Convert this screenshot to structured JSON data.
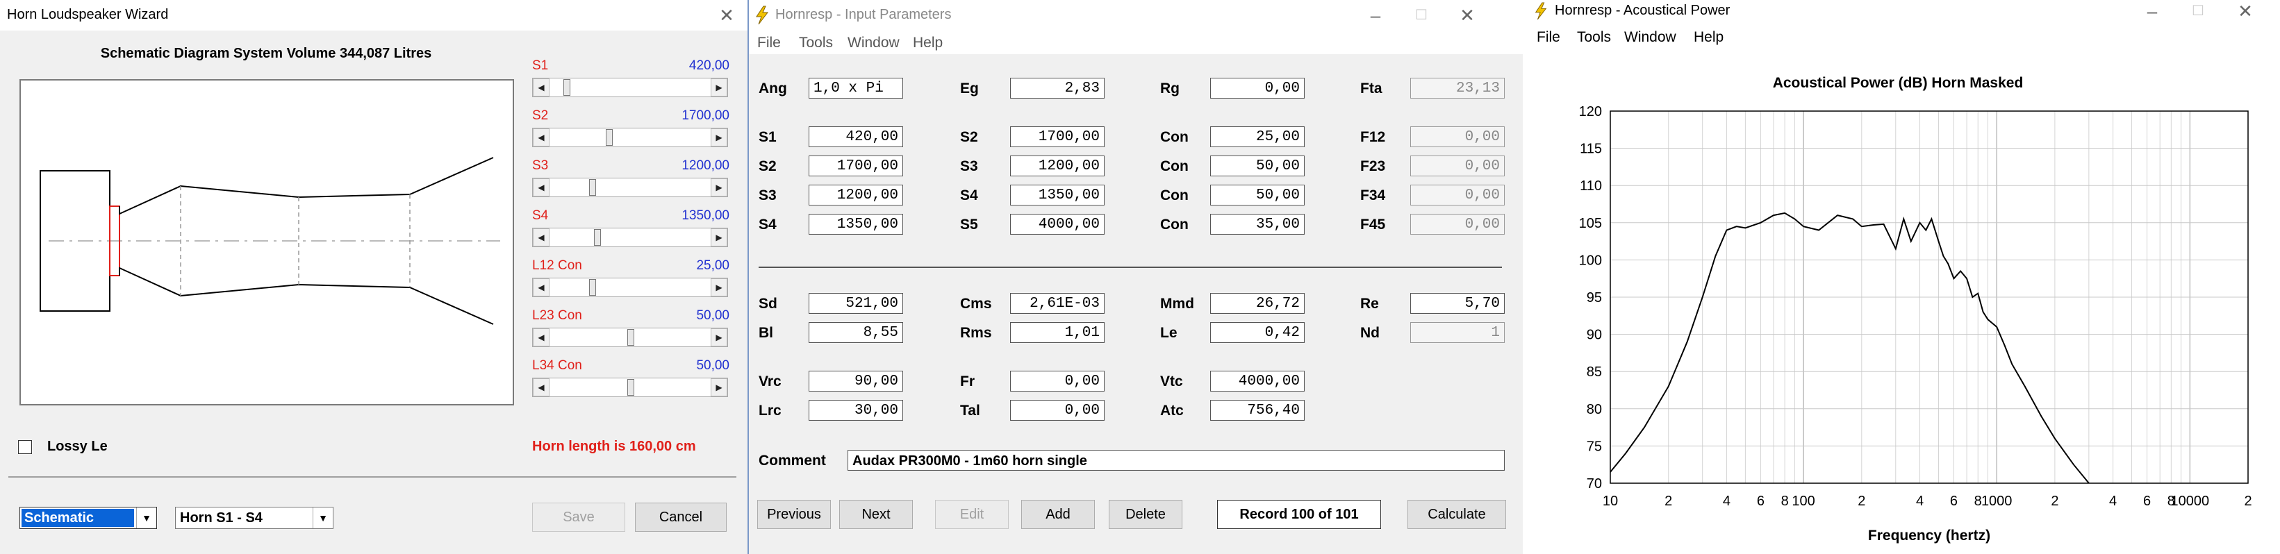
{
  "wizard": {
    "title": "Horn Loudspeaker Wizard",
    "close": "✕",
    "schematic_heading": "Schematic Diagram   System Volume 344,087 Litres",
    "sliders": [
      {
        "label": "S1",
        "value": "420,00",
        "position": 0.08
      },
      {
        "label": "S2",
        "value": "1700,00",
        "position": 0.36
      },
      {
        "label": "S3",
        "value": "1200,00",
        "position": 0.25
      },
      {
        "label": "S4",
        "value": "1350,00",
        "position": 0.28
      },
      {
        "label": "L12 Con",
        "value": "25,00",
        "position": 0.25
      },
      {
        "label": "L23 Con",
        "value": "50,00",
        "position": 0.5
      },
      {
        "label": "L34 Con",
        "value": "50,00",
        "position": 0.5
      }
    ],
    "lossy_label": "Lossy Le",
    "horn_length": "Horn length is 160,00 cm",
    "view_combo": "Schematic",
    "horn_combo": "Horn S1 - S4",
    "save_label": "Save",
    "cancel_label": "Cancel"
  },
  "input": {
    "title": "Hornresp - Input Parameters",
    "menu": [
      "File",
      "Tools",
      "Window",
      "Help"
    ],
    "params": [
      [
        {
          "l": "Ang",
          "v": "1,0 x Pi",
          "left": true
        },
        {
          "l": "Eg",
          "v": "2,83"
        },
        {
          "l": "Rg",
          "v": "0,00"
        },
        {
          "l": "Fta",
          "v": "23,13",
          "ro": true
        }
      ],
      [
        {
          "l": "S1",
          "v": "420,00"
        },
        {
          "l": "S2",
          "v": "1700,00"
        },
        {
          "l": "Con",
          "v": "25,00"
        },
        {
          "l": "F12",
          "v": "0,00",
          "ro": true
        }
      ],
      [
        {
          "l": "S2",
          "v": "1700,00"
        },
        {
          "l": "S3",
          "v": "1200,00"
        },
        {
          "l": "Con",
          "v": "50,00"
        },
        {
          "l": "F23",
          "v": "0,00",
          "ro": true
        }
      ],
      [
        {
          "l": "S3",
          "v": "1200,00"
        },
        {
          "l": "S4",
          "v": "1350,00"
        },
        {
          "l": "Con",
          "v": "50,00"
        },
        {
          "l": "F34",
          "v": "0,00",
          "ro": true
        }
      ],
      [
        {
          "l": "S4",
          "v": "1350,00"
        },
        {
          "l": "S5",
          "v": "4000,00"
        },
        {
          "l": "Con",
          "v": "35,00"
        },
        {
          "l": "F45",
          "v": "0,00",
          "ro": true
        }
      ],
      [
        {
          "l": "Sd",
          "v": "521,00"
        },
        {
          "l": "Cms",
          "v": "2,61E-03"
        },
        {
          "l": "Mmd",
          "v": "26,72"
        },
        {
          "l": "Re",
          "v": "5,70"
        }
      ],
      [
        {
          "l": "Bl",
          "v": "8,55"
        },
        {
          "l": "Rms",
          "v": "1,01"
        },
        {
          "l": "Le",
          "v": "0,42"
        },
        {
          "l": "Nd",
          "v": "1",
          "ro": true
        }
      ],
      [
        {
          "l": "Vrc",
          "v": "90,00"
        },
        {
          "l": "Fr",
          "v": "0,00"
        },
        {
          "l": "Vtc",
          "v": "4000,00"
        }
      ],
      [
        {
          "l": "Lrc",
          "v": "30,00"
        },
        {
          "l": "Tal",
          "v": "0,00"
        },
        {
          "l": "Atc",
          "v": "756,40"
        }
      ]
    ],
    "comment_label": "Comment",
    "comment": "Audax PR300M0 - 1m60 horn single",
    "buttons": {
      "previous": "Previous",
      "next": "Next",
      "edit": "Edit",
      "add": "Add",
      "delete": "Delete",
      "calculate": "Calculate"
    },
    "record": "Record 100 of 101"
  },
  "power": {
    "title": "Hornresp - Acoustical Power",
    "menu": [
      "File",
      "Tools",
      "Window",
      "Help"
    ]
  },
  "chart_data": {
    "type": "line",
    "title": "Acoustical Power (dB)   Horn   Masked",
    "xlabel": "Frequency (hertz)",
    "ylabel": "",
    "x_scale": "log",
    "xlim": [
      10,
      20000
    ],
    "ylim": [
      70,
      120
    ],
    "y_ticks": [
      70,
      75,
      80,
      85,
      90,
      95,
      100,
      105,
      110,
      115,
      120
    ],
    "x_tick_labels": [
      {
        "x": 10,
        "t": "10"
      },
      {
        "x": 20,
        "t": "2"
      },
      {
        "x": 40,
        "t": "4"
      },
      {
        "x": 60,
        "t": "6"
      },
      {
        "x": 80,
        "t": "8"
      },
      {
        "x": 100,
        "t": "100"
      },
      {
        "x": 200,
        "t": "2"
      },
      {
        "x": 400,
        "t": "4"
      },
      {
        "x": 600,
        "t": "6"
      },
      {
        "x": 800,
        "t": "8"
      },
      {
        "x": 1000,
        "t": "1000"
      },
      {
        "x": 2000,
        "t": "2"
      },
      {
        "x": 4000,
        "t": "4"
      },
      {
        "x": 6000,
        "t": "6"
      },
      {
        "x": 8000,
        "t": "8"
      },
      {
        "x": 10000,
        "t": "10000"
      },
      {
        "x": 20000,
        "t": "2"
      }
    ],
    "grid": true,
    "series": [
      {
        "x": [
          10,
          12,
          15,
          20,
          25,
          30,
          35,
          40,
          45,
          50,
          60,
          70,
          80,
          90,
          100,
          120,
          150,
          180,
          200,
          230,
          260,
          300,
          330,
          360,
          400,
          430,
          460,
          500,
          530,
          560,
          600,
          650,
          700,
          750,
          800,
          850,
          900,
          1000,
          1100,
          1200,
          1400,
          1700,
          2000,
          2500,
          3000
        ],
        "y": [
          71.5,
          74,
          77.5,
          83,
          89,
          95,
          100.5,
          104,
          104.5,
          104.3,
          105,
          106,
          106.3,
          105.5,
          104.5,
          104,
          106,
          105.5,
          104.5,
          104.7,
          104.8,
          101.5,
          105.5,
          102.5,
          105,
          104,
          105.5,
          102.5,
          100.5,
          99.5,
          97.5,
          98.5,
          97.5,
          95,
          95.5,
          93,
          92,
          91,
          88.5,
          86,
          83,
          79,
          76,
          72.5,
          70
        ]
      }
    ]
  }
}
